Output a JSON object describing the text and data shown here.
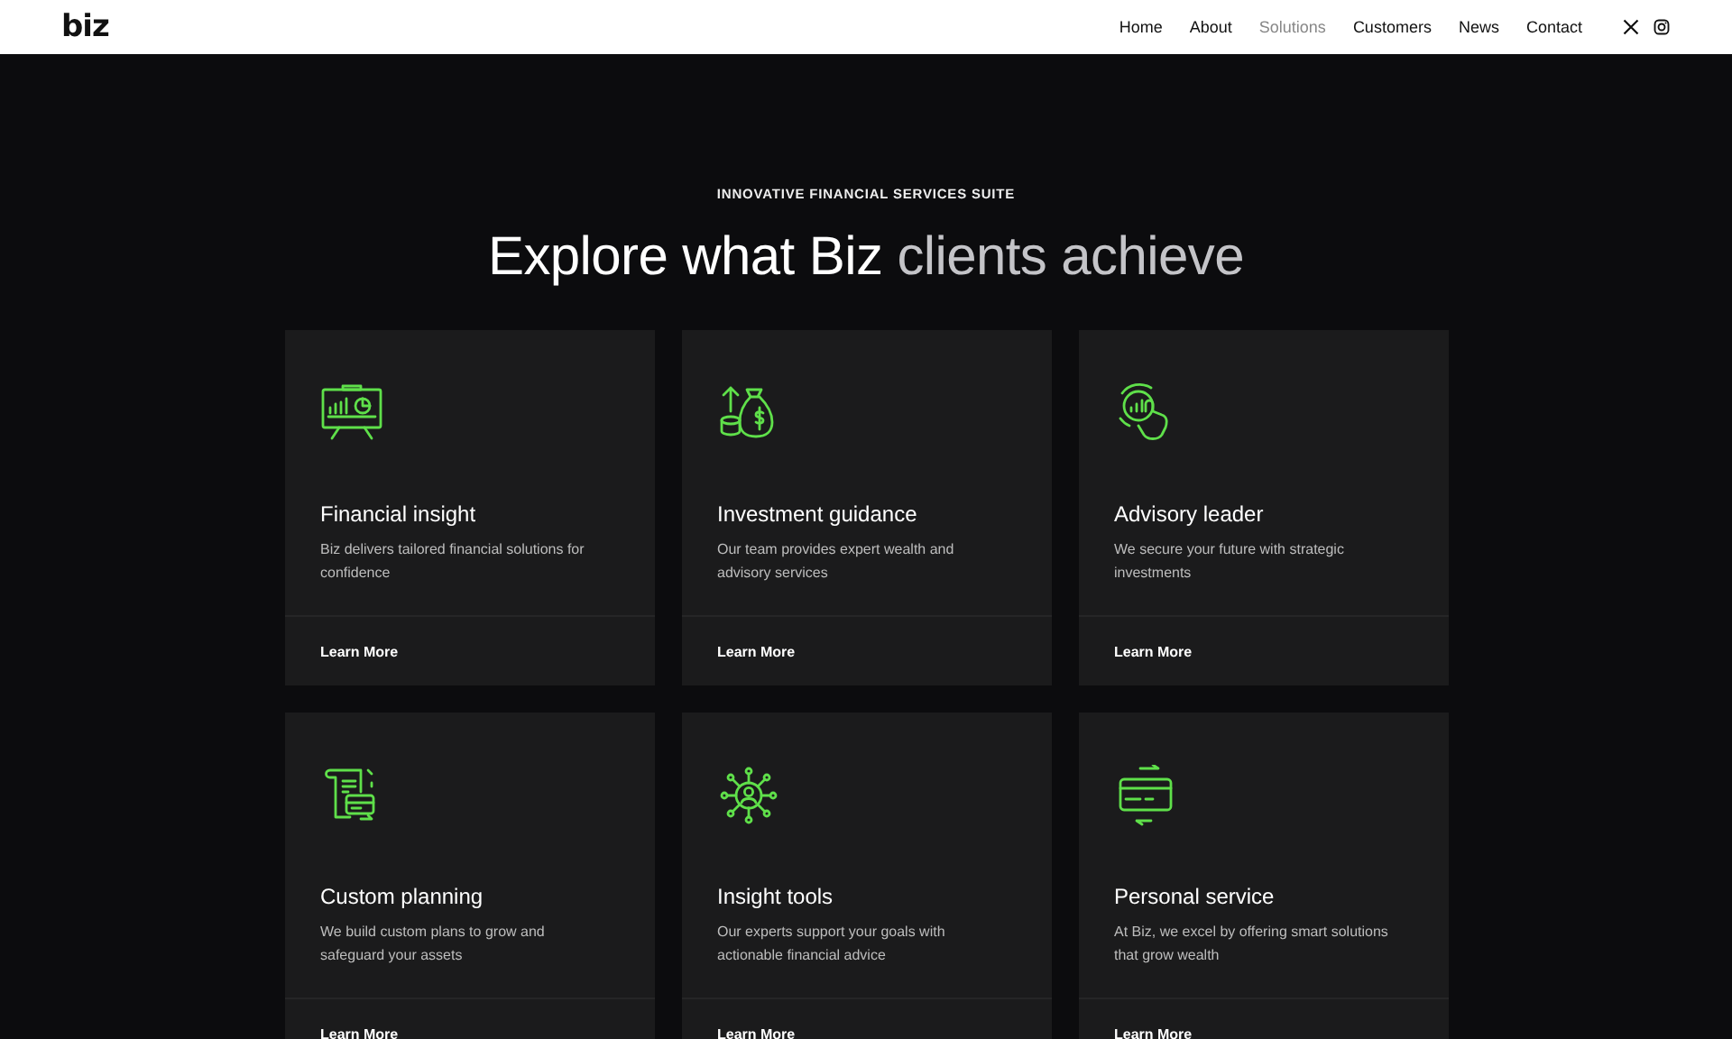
{
  "header": {
    "logo": "biz",
    "nav": [
      {
        "label": "Home",
        "selected": false
      },
      {
        "label": "About",
        "selected": false
      },
      {
        "label": "Solutions",
        "selected": true
      },
      {
        "label": "Customers",
        "selected": false
      },
      {
        "label": "News",
        "selected": false
      },
      {
        "label": "Contact",
        "selected": false
      }
    ],
    "social": [
      {
        "kind": "x"
      },
      {
        "kind": "instagram"
      }
    ]
  },
  "hero": {
    "eyebrow": "INNOVATIVE FINANCIAL SERVICES SUITE",
    "title": "Explore what Biz",
    "title_muted": "clients achieve"
  },
  "cards": [
    {
      "title": "Financial insight",
      "text": "Biz delivers tailored financial solutions for confidence",
      "link": "Learn More"
    },
    {
      "title": "Investment guidance",
      "text": "Our team provides expert wealth and advisory services",
      "link": "Learn More"
    },
    {
      "title": "Advisory leader",
      "text": "We secure your future with strategic investments",
      "link": "Learn More"
    },
    {
      "title": "Custom planning",
      "text": "We build custom plans to grow and safeguard your assets",
      "link": "Learn More"
    },
    {
      "title": "Insight tools",
      "text": "Our experts support your goals with actionable financial advice",
      "link": "Learn More"
    },
    {
      "title": "Personal service",
      "text": "At Biz, we excel by offering smart solutions that grow wealth",
      "link": "Learn More"
    }
  ]
}
